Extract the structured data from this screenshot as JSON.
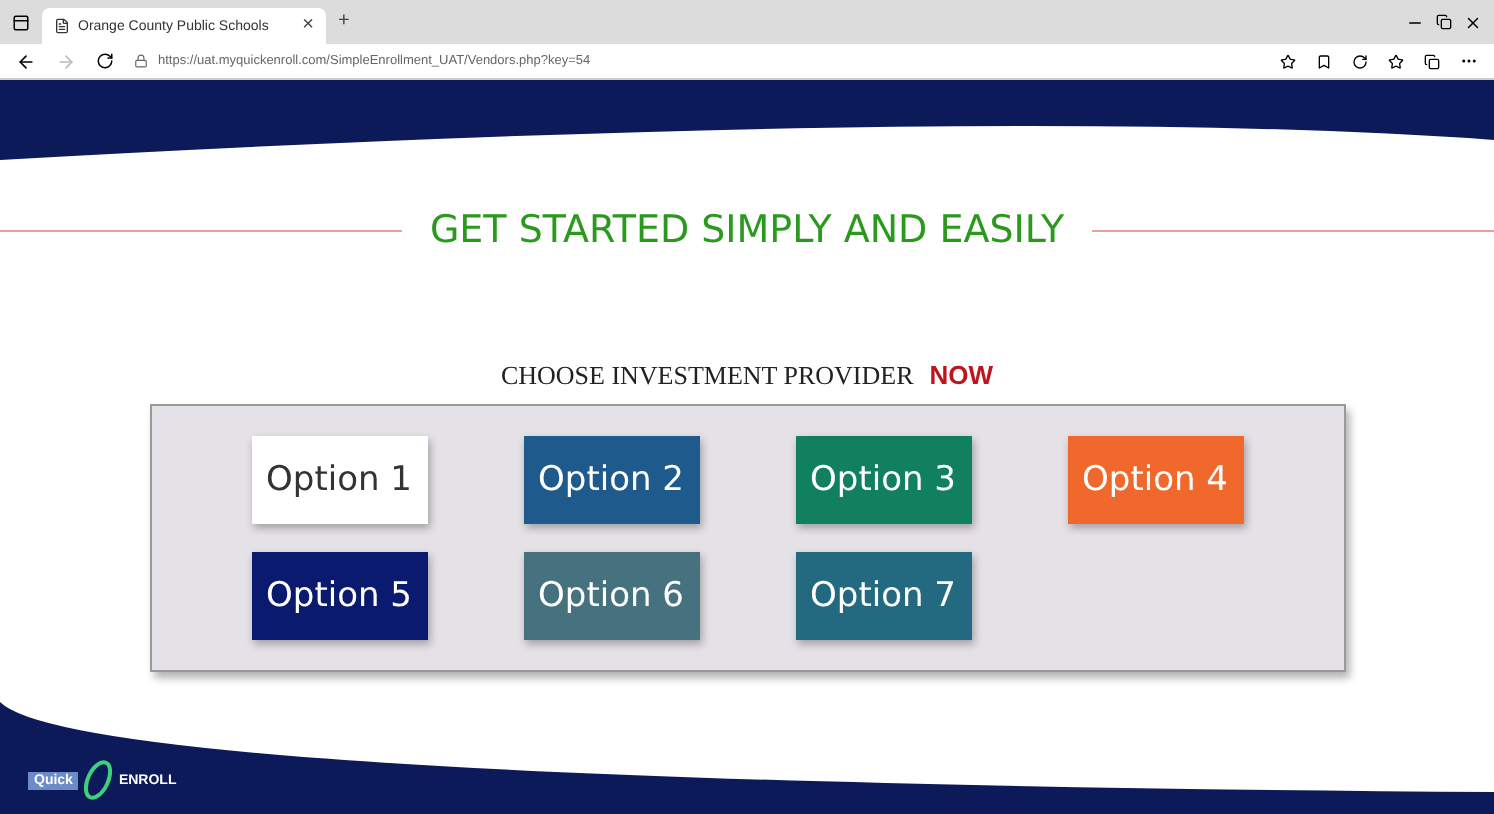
{
  "browser": {
    "tab_title": "Orange County Public Schools",
    "tab_close": "×",
    "new_tab": "+",
    "url": "https://uat.myquickenroll.com/SimpleEnrollment_UAT/Vendors.php?key=54"
  },
  "page": {
    "heading": "GET STARTED SIMPLY AND EASILY",
    "prompt": "CHOOSE INVESTMENT PROVIDER",
    "prompt_emphasis": "NOW"
  },
  "options": [
    {
      "label": "Option 1",
      "color": "#ffffff"
    },
    {
      "label": "Option 2",
      "color": "#1f5a8c"
    },
    {
      "label": "Option 3",
      "color": "#10805e"
    },
    {
      "label": "Option 4",
      "color": "#f0682c"
    },
    {
      "label": "Option 5",
      "color": "#0a1a6e"
    },
    {
      "label": "Option 6",
      "color": "#46717f"
    },
    {
      "label": "Option 7",
      "color": "#236a80"
    }
  ],
  "logo": {
    "left": "Quick",
    "right": "ENROLL"
  }
}
